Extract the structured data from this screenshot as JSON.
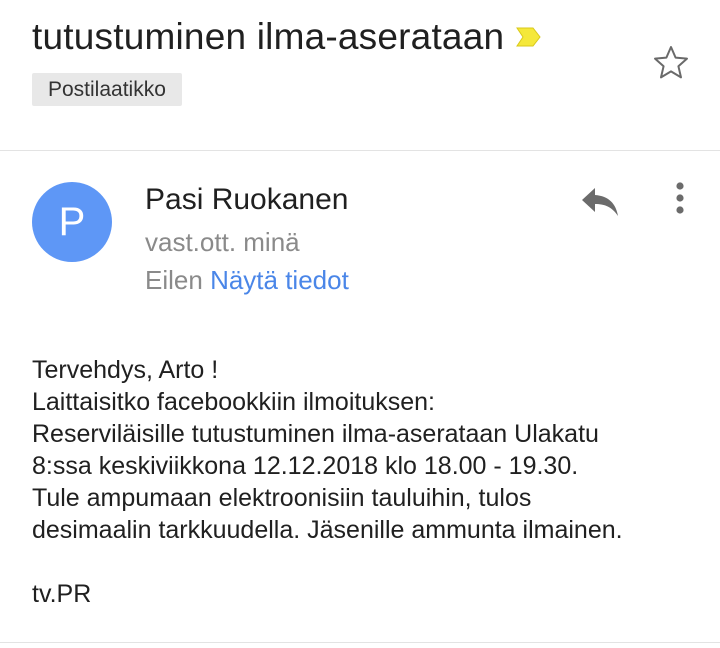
{
  "message": {
    "subject": "tutustuminen ilma-aserataan",
    "label": "Postilaatikko",
    "sender_initial": "P",
    "sender_name": "Pasi Ruokanen",
    "recipient": "vast.ott. minä",
    "date": "Eilen",
    "details_link": "Näytä tiedot",
    "body_lines": [
      "Tervehdys, Arto !",
      "Laittaisitko facebookkiin ilmoituksen:",
      "Reserviläisille tutustuminen ilma-aserataan Ulakatu",
      "8:ssa keskiviikkona 12.12.2018 klo 18.00 - 19.30.",
      "Tule ampumaan elektroonisiin tauluihin, tulos",
      "desimaalin tarkkuudella. Jäsenille ammunta ilmainen.",
      "",
      "tv.PR"
    ]
  },
  "icons": {
    "importance": "importance-marker-icon",
    "star": "star-outline-icon",
    "reply": "reply-icon",
    "more": "more-vertical-icon"
  },
  "colors": {
    "avatar": "#5e97f6",
    "link": "#4a86e8",
    "importance": "#f5e83a",
    "secondary_text": "#8a8a8a",
    "chip_background": "#e8e8e8"
  }
}
